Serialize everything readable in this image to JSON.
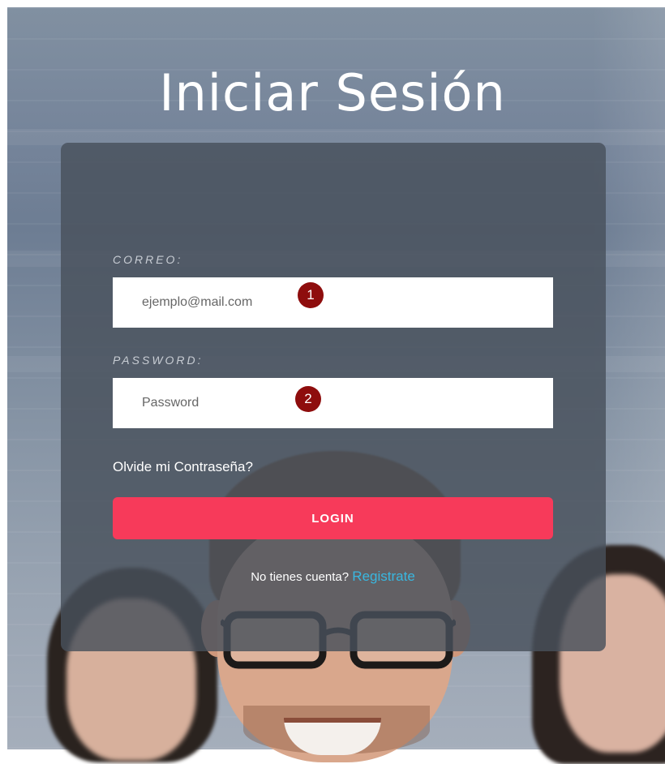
{
  "page": {
    "title": "Iniciar Sesión"
  },
  "form": {
    "email_label": "CORREO:",
    "email_placeholder": "ejemplo@mail.com",
    "password_label": "PASSWORD:",
    "password_placeholder": "Password",
    "forgot_link": "Olvide mi Contraseña?",
    "login_button": "LOGIN",
    "no_account_text": "No tienes cuenta?",
    "register_link": "Registrate"
  },
  "markers": [
    "1",
    "2"
  ],
  "colors": {
    "accent": "#f73a5a",
    "link": "#39b7e0",
    "marker": "#8e0d0d",
    "card": "#48505c"
  }
}
